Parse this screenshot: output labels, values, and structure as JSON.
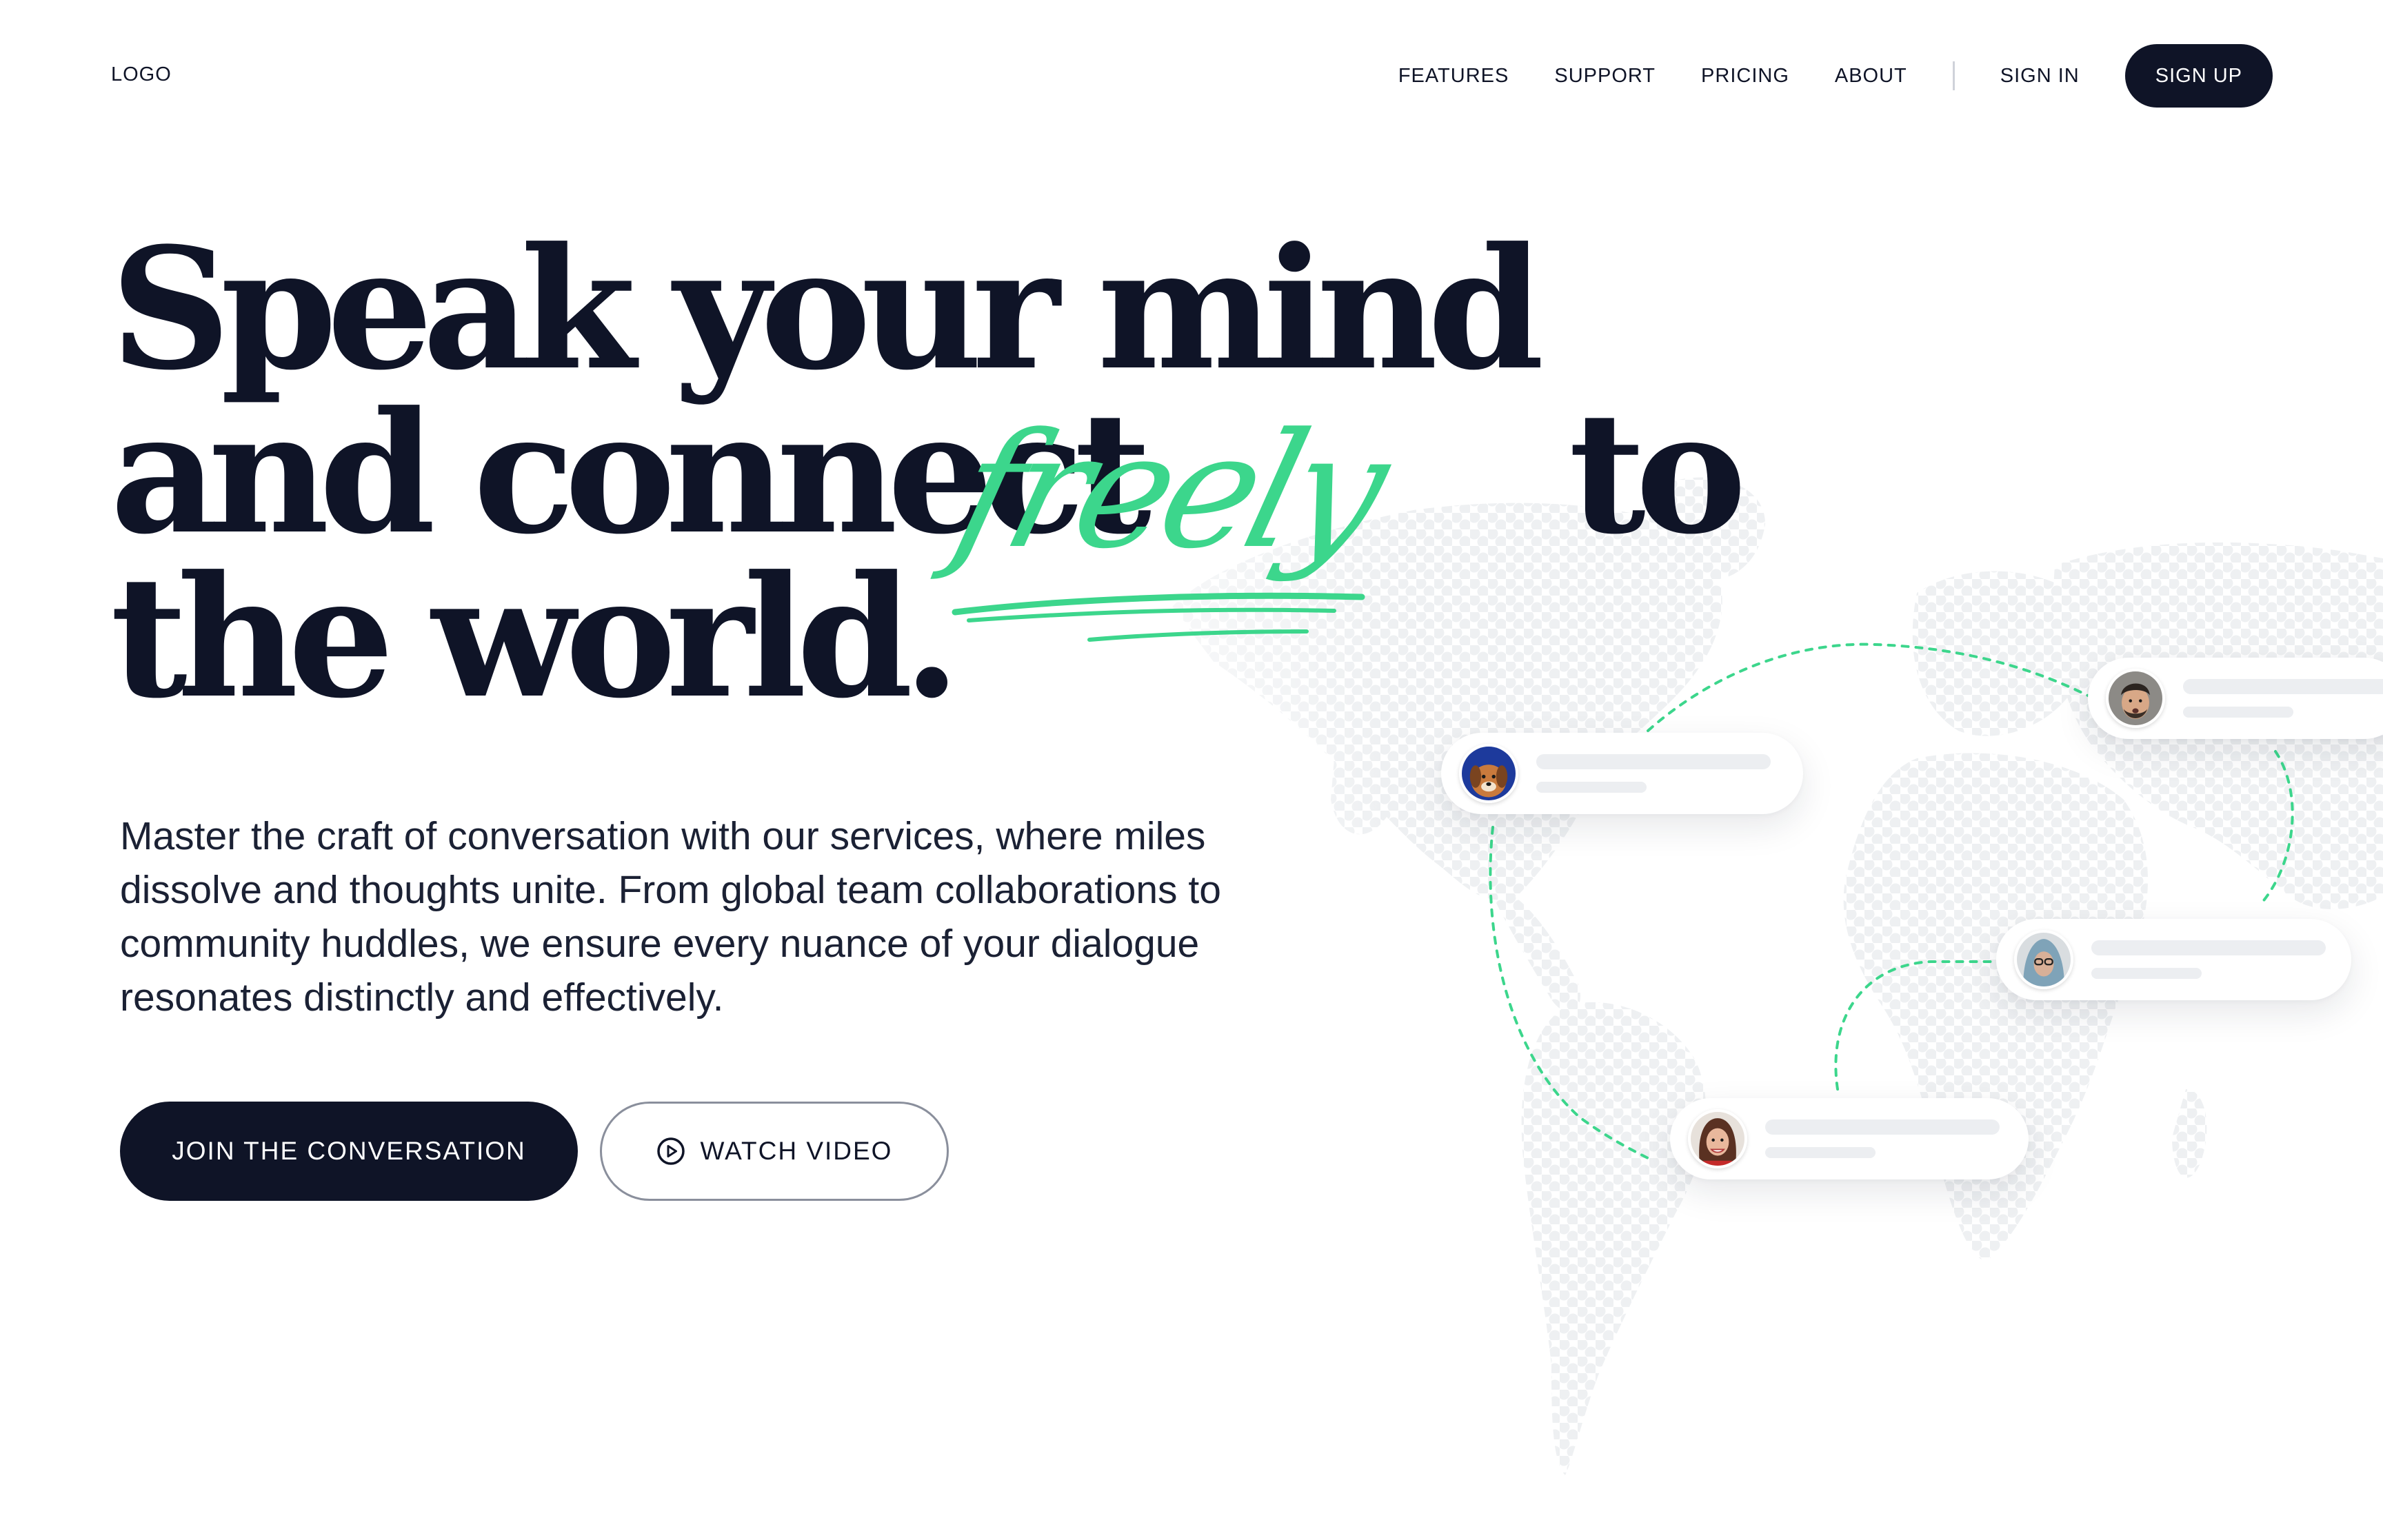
{
  "header": {
    "logo": "LOGO",
    "nav": [
      {
        "label": "FEATURES"
      },
      {
        "label": "SUPPORT"
      },
      {
        "label": "PRICING"
      },
      {
        "label": "ABOUT"
      }
    ],
    "sign_in": "SIGN IN",
    "sign_up": "SIGN UP"
  },
  "hero": {
    "headline_line1": "Speak your mind",
    "headline_line2_start": "and connect",
    "headline_accent": "freely",
    "headline_line2_end": "to",
    "headline_line3": "the world.",
    "lead": "Master the craft of conversation with our services, where miles dissolve and thoughts unite. From global team collaborations to community huddles, we ensure every nuance of your dialogue resonates distinctly and effectively.",
    "cta_primary": "JOIN THE CONVERSATION",
    "cta_secondary": "WATCH VIDEO"
  },
  "colors": {
    "ink": "#0f1427",
    "accent_green": "#3cd68c",
    "map_dots": "#eef0f2",
    "bubble_lines": "#eceef1"
  },
  "icons": [
    "play-circle-icon"
  ]
}
